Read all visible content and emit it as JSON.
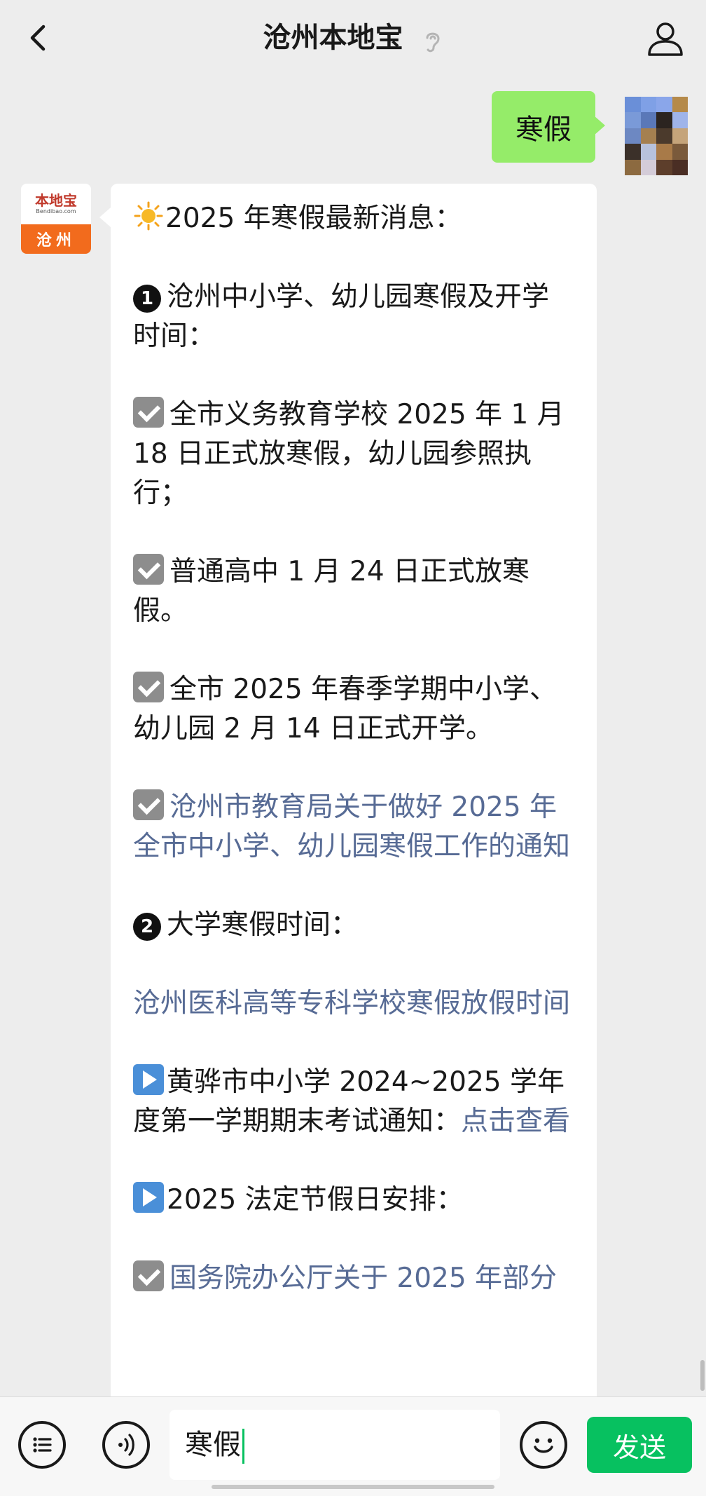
{
  "header": {
    "title": "沧州本地宝",
    "back_icon": "chevron-left-icon",
    "ear_icon": "ear-icon",
    "user_icon": "user-icon"
  },
  "sent_message": {
    "text": "寒假"
  },
  "bot_avatar": {
    "brand": "本地宝",
    "site": "Bendibao.com",
    "city": "沧州"
  },
  "reply": {
    "heading": "2025 年寒假最新消息：",
    "section1_title": "沧州中小学、幼儿园寒假及开学时间：",
    "item1": "全市义务教育学校 2025 年 1 月 18 日正式放寒假，幼儿园参照执行；",
    "item2": "普通高中 1 月 24 日正式放寒假。",
    "item3": "全市 2025 年春季学期中小学、幼儿园 2 月 14 日正式开学。",
    "item4_link": "沧州市教育局关于做好 2025 年全市中小学、幼儿园寒假工作的通知",
    "section2_title": "大学寒假时间：",
    "college_link": "沧州医科高等专科学校寒假放假时间",
    "huanghua_text": "黄骅市中小学 2024~2025 学年度第一学期期末考试通知：",
    "huanghua_link": "点击查看",
    "holiday_title": "2025 法定节假日安排：",
    "holiday_link": "国务院办公厅关于 2025 年部分"
  },
  "input_bar": {
    "value": "寒假",
    "send_label": "发送",
    "menu_icon": "list-icon",
    "voice_icon": "voice-icon",
    "emoji_icon": "emoji-icon"
  },
  "colors": {
    "accent": "#07c160",
    "bubble_sent": "#95ec69",
    "link": "#576b95",
    "brand_orange": "#f26b1d"
  }
}
